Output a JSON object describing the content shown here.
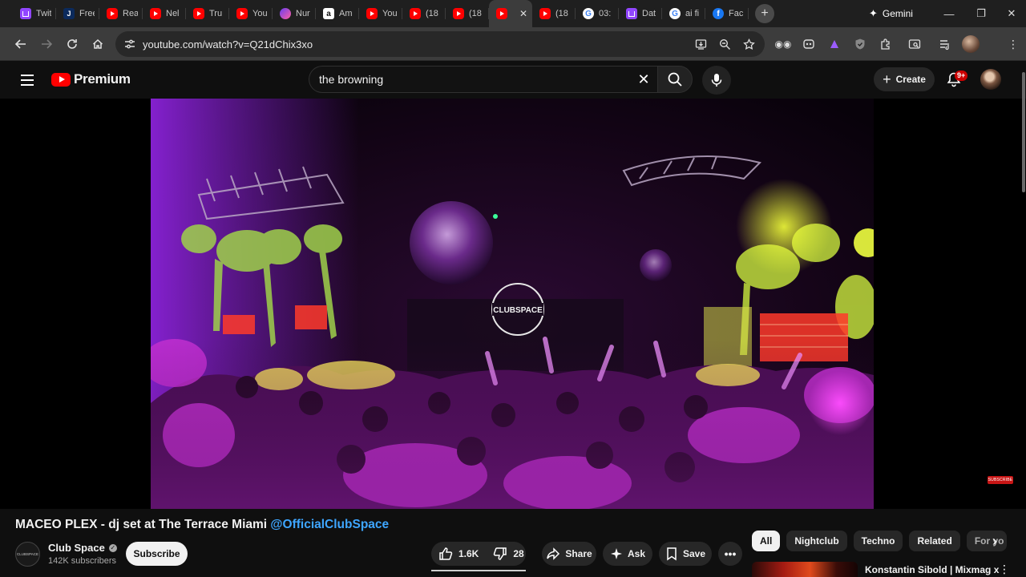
{
  "browser": {
    "tabs": [
      {
        "title": "Twit",
        "favicon": "twitch-icon"
      },
      {
        "title": "Free",
        "favicon": "j-icon"
      },
      {
        "title": "Rea",
        "favicon": "youtube-icon"
      },
      {
        "title": "Nel",
        "favicon": "youtube-icon"
      },
      {
        "title": "Tru",
        "favicon": "youtube-icon"
      },
      {
        "title": "You",
        "favicon": "youtube-icon"
      },
      {
        "title": "Nur",
        "favicon": "nu-icon"
      },
      {
        "title": "Am",
        "favicon": "amazon-icon"
      },
      {
        "title": "You",
        "favicon": "youtube-icon"
      },
      {
        "title": "(18",
        "favicon": "youtube-icon"
      },
      {
        "title": "(18",
        "favicon": "youtube-icon"
      },
      {
        "title": "",
        "favicon": "youtube-icon",
        "active": true
      },
      {
        "title": "(18",
        "favicon": "youtube-icon"
      },
      {
        "title": "03:",
        "favicon": "google-icon"
      },
      {
        "title": "Dat",
        "favicon": "twitch-icon"
      },
      {
        "title": "ai fi",
        "favicon": "google-icon"
      },
      {
        "title": "Fac",
        "favicon": "facebook-icon"
      }
    ],
    "gemini_label": "Gemini",
    "url": "youtube.com/watch?v=Q21dChix3xo"
  },
  "youtube": {
    "logo_text": "Premium",
    "search_value": "the browning",
    "create_label": "Create",
    "notification_badge": "9+",
    "video": {
      "overlay_logo": "CLUBSPACE",
      "subscribe_watermark": "SUBSCRIBE"
    },
    "title_text": "MACEO PLEX - dj set at The Terrace Miami ",
    "title_link": "@OfficialClubSpace",
    "channel": {
      "name": "Club Space",
      "verified_mark": "✓",
      "subscribers": "142K subscribers",
      "avatar_text": "CLUBSPACE",
      "subscribe_label": "Subscribe"
    },
    "actions": {
      "likes": "1.6K",
      "dislikes": "28",
      "share": "Share",
      "ask": "Ask",
      "save": "Save"
    },
    "chips": [
      "All",
      "Nightclub",
      "Techno",
      "Related",
      "For yo"
    ],
    "recommendation": {
      "title": "Konstantin Sibold | Mixmag x"
    }
  },
  "colors": {
    "youtube_red": "#ff0000",
    "link_blue": "#3ea6ff",
    "background": "#0f0f0f"
  }
}
